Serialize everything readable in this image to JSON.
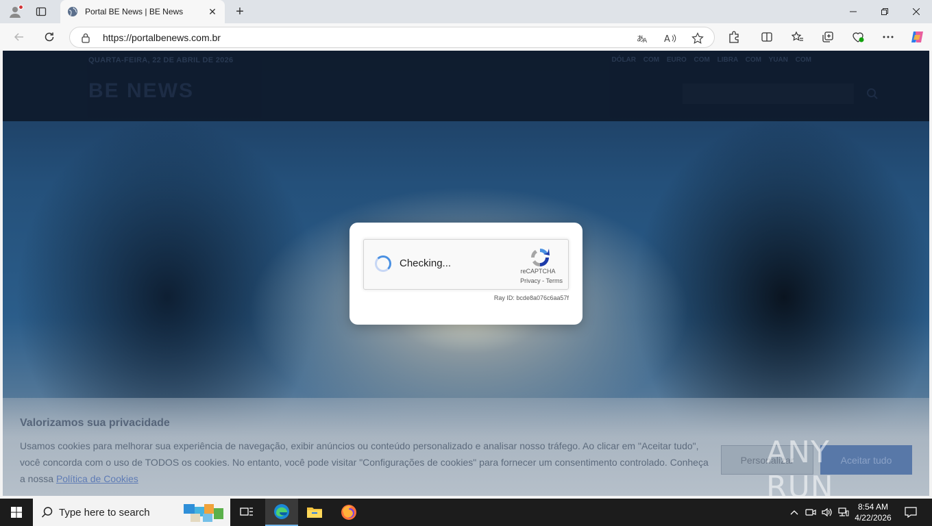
{
  "browser": {
    "tab": {
      "title": "Portal BE News | BE News",
      "close_glyph": "✕"
    },
    "new_tab_glyph": "+",
    "url": "https://portalbenews.com.br"
  },
  "site": {
    "date": "QUARTA-FEIRA, 22 DE ABRIL DE 2026",
    "quotes": "DÓLAR COM EURO COM LIBRA COM YUAN COM",
    "logo": "BE NEWS"
  },
  "captcha": {
    "status": "Checking...",
    "brand": "reCAPTCHA",
    "privacy": "Privacy",
    "separator": " - ",
    "terms": "Terms",
    "ray_id": "Ray ID: bcde8a076c6aa57f"
  },
  "cookie_banner": {
    "title": "Valorizamos sua privacidade",
    "text": "Usamos cookies para melhorar sua experiência de navegação, exibir anúncios ou conteúdo personalizado e analisar nosso tráfego. Ao clicar em \"Aceitar tudo\", você concorda com o uso de TODOS os cookies. No entanto, você pode visitar \"Configurações de cookies\" para fornecer um consentimento controlado. Conheça a nossa",
    "link": "Política de Cookies",
    "customize_label": "Personalizar",
    "accept_label": "Aceitar tudo"
  },
  "watermark": "ANY RUN",
  "taskbar": {
    "search_placeholder": "Type here to search",
    "time": "8:54 AM",
    "date": "4/22/2026"
  }
}
